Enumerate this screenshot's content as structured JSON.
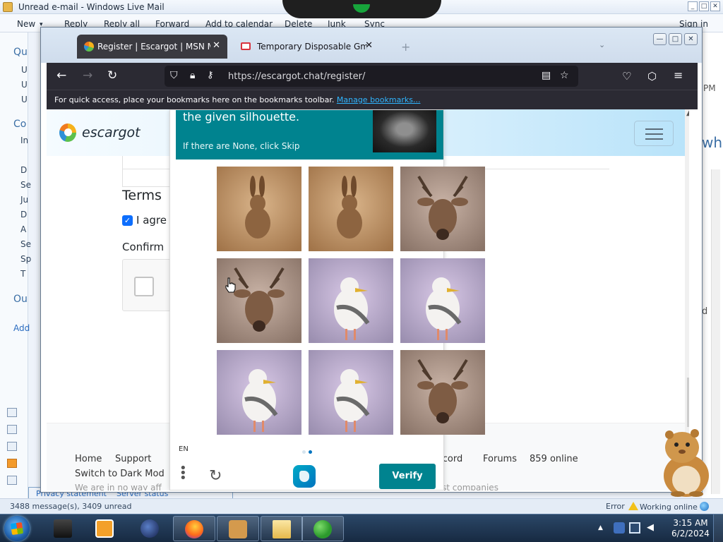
{
  "wlm": {
    "title": "Unread e-mail - Windows Live Mail",
    "toolbar": [
      "New",
      "Reply",
      "Reply all",
      "Forward",
      "Add to calendar",
      "Delete",
      "Junk",
      "Sync",
      "Sign in"
    ],
    "sidebar_fragments": [
      "Qu",
      "U",
      "U",
      "U",
      "Co",
      "In",
      "D",
      "Se",
      "Ju",
      "D",
      "A",
      "Se",
      "Sp",
      "T",
      "Ou",
      "Add"
    ],
    "right_fragments": [
      "PM",
      "wh",
      "d"
    ],
    "footer_links": [
      "Privacy statement",
      "Server status"
    ],
    "status_left": "3488 message(s), 3409 unread",
    "status_error": "Error",
    "status_online": "Working online"
  },
  "firefox": {
    "tabs": [
      {
        "label": "Register | Escargot | MSN Messenger",
        "active": true
      },
      {
        "label": "Temporary Disposable Gmail | Temp Gmail",
        "active": false
      }
    ],
    "url": "https://escargot.chat/register/",
    "bookmarks_hint": "For quick access, place your bookmarks here on the bookmarks toolbar.",
    "bookmarks_link": "Manage bookmarks..."
  },
  "page": {
    "logo_text": "escargot",
    "terms_heading": "Terms",
    "agree_label": "I agre",
    "confirm_label": "Confirm",
    "footer": {
      "home": "Home",
      "support": "Support",
      "discord": "scord",
      "forums": "Forums",
      "online": "859 online",
      "dark_mode": "Switch to Dark Mod",
      "disclaimer_left": "We are in no way aff",
      "disclaimer_right": "st companies"
    }
  },
  "captcha": {
    "prompt_line": "the given silhouette.",
    "prompt_hint": "If there are None, click Skip",
    "images": [
      "rabbit",
      "rabbit",
      "deer",
      "deer",
      "seagull",
      "seagull",
      "seagull",
      "seagull",
      "deer"
    ],
    "language": "EN",
    "page_dots": [
      false,
      true
    ],
    "verify_label": "Verify"
  },
  "taskbar": {
    "time": "3:15 AM",
    "date": "6/2/2024"
  },
  "colors": {
    "captcha_teal": "#00838f",
    "firefox_dark": "#2b2a33",
    "link_blue": "#2fb5ff"
  }
}
